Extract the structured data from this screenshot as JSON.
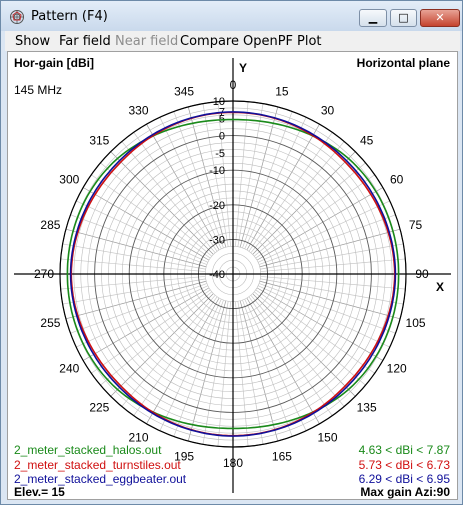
{
  "window": {
    "title": "Pattern   (F4)",
    "min_glyph": "▁",
    "max_glyph": "□",
    "close_glyph": "✕"
  },
  "menu": {
    "show": "Show",
    "far_field": "Far field",
    "near_field": "Near field",
    "compare": "Compare",
    "openpf": "OpenPF",
    "plot": "Plot"
  },
  "plot": {
    "gain_label": "Hor-gain [dBi]",
    "plane_label": "Horizontal plane",
    "frequency": "145 MHz",
    "y_axis_letter": "Y",
    "x_axis_letter": "X",
    "elevation": "Elev.= 15",
    "max_gain": "Max gain Azi:90"
  },
  "legend": [
    {
      "file": "2_meter_stacked_halos.out",
      "range": "4.63 < dBi < 7.87",
      "color": "#1a8a1a"
    },
    {
      "file": "2_meter_stacked_turnstiles.out",
      "range": "5.73 < dBi < 6.73",
      "color": "#d01010"
    },
    {
      "file": "2_meter_stacked_eggbeater.out",
      "range": "6.29 < dBi < 6.95",
      "color": "#10109a"
    }
  ],
  "chart_data": {
    "type": "polar",
    "angle_labels": [
      "0",
      "15",
      "30",
      "45",
      "60",
      "75",
      "90",
      "105",
      "120",
      "135",
      "150",
      "165",
      "180",
      "195",
      "210",
      "225",
      "240",
      "255",
      "270",
      "285",
      "300",
      "315",
      "330",
      "345"
    ],
    "radial_labels": [
      "10",
      "7",
      "5",
      "0",
      "-5",
      "-10",
      "-20",
      "-30",
      "-40"
    ],
    "radial_range_dbi": [
      -40,
      10
    ],
    "series": [
      {
        "name": "2_meter_stacked_halos.out",
        "color": "#1a8a1a",
        "azimuth_deg": [
          0,
          15,
          30,
          45,
          60,
          75,
          90,
          105,
          120,
          135,
          150,
          165,
          180,
          195,
          210,
          225,
          240,
          255,
          270,
          285,
          300,
          315,
          330,
          345
        ],
        "gain_dbi": [
          4.63,
          5.1,
          6.1,
          7.2,
          7.7,
          7.85,
          7.87,
          7.85,
          7.7,
          7.2,
          6.1,
          5.1,
          4.63,
          5.1,
          6.1,
          7.2,
          7.7,
          7.85,
          7.87,
          7.85,
          7.7,
          7.2,
          6.1,
          5.1
        ]
      },
      {
        "name": "2_meter_stacked_turnstiles.out",
        "color": "#d01010",
        "azimuth_deg": [
          0,
          15,
          30,
          45,
          60,
          75,
          90,
          105,
          120,
          135,
          150,
          165,
          180,
          195,
          210,
          225,
          240,
          255,
          270,
          285,
          300,
          315,
          330,
          345
        ],
        "gain_dbi": [
          6.73,
          6.6,
          6.2,
          5.8,
          6.0,
          6.45,
          6.73,
          6.45,
          6.0,
          5.8,
          6.2,
          6.6,
          6.73,
          6.6,
          6.2,
          5.8,
          6.0,
          6.45,
          6.73,
          6.45,
          6.0,
          5.8,
          6.2,
          6.6
        ]
      },
      {
        "name": "2_meter_stacked_eggbeater.out",
        "color": "#10109a",
        "azimuth_deg": [
          0,
          15,
          30,
          45,
          60,
          75,
          90,
          105,
          120,
          135,
          150,
          165,
          180,
          195,
          210,
          225,
          240,
          255,
          270,
          285,
          300,
          315,
          330,
          345
        ],
        "gain_dbi": [
          6.85,
          6.7,
          6.5,
          6.35,
          6.5,
          6.75,
          6.95,
          6.75,
          6.5,
          6.35,
          6.5,
          6.7,
          6.85,
          6.7,
          6.5,
          6.35,
          6.5,
          6.75,
          6.95,
          6.75,
          6.5,
          6.35,
          6.5,
          6.7
        ]
      }
    ]
  }
}
